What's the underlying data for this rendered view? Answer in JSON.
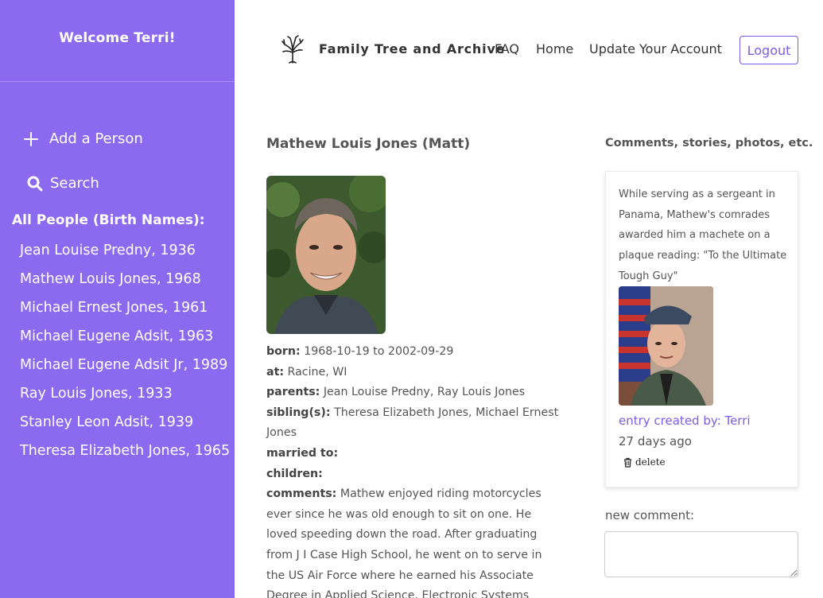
{
  "sidebar": {
    "welcome": "Welcome Terri!",
    "add_person": "Add a Person",
    "search": "Search",
    "people_title": "All People (Birth Names):",
    "people": [
      "Jean Louise Predny, 1936",
      "Mathew Louis Jones, 1968",
      "Michael Ernest Jones, 1961",
      "Michael Eugene Adsit, 1963",
      "Michael Eugene Adsit Jr, 1989",
      "Ray Louis Jones, 1933",
      "Stanley Leon Adsit, 1939",
      "Theresa Elizabeth Jones, 1965"
    ],
    "color": "#8c6af0"
  },
  "header": {
    "brand": "Family Tree and Archive",
    "nav": {
      "faq": "FAQ",
      "home": "Home",
      "update": "Update Your Account"
    },
    "logout": "Logout",
    "accent": "#7b5ce6"
  },
  "person": {
    "name": "Mathew Louis Jones (Matt)",
    "born_label": "born:",
    "born": "1968-10-19 to 2002-09-29",
    "at_label": "at:",
    "at": "Racine, WI",
    "parents_label": "parents:",
    "parents": "Jean Louise Predny, Ray Louis Jones",
    "siblings_label": "sibling(s):",
    "siblings": "Theresa Elizabeth Jones, Michael Ernest Jones",
    "married_label": "married to:",
    "married": "",
    "children_label": "children:",
    "children": "",
    "comments_label": "comments:",
    "comments": "Mathew enjoyed riding motorcycles ever since he was old enough to sit on one. He loved speeding down the road. After graduating from J I Case High School, he went on to serve in the US Air Force where he earned his Associate Degree in Applied Science, Electronic Systems"
  },
  "comments": {
    "title": "Comments, stories, photos, etc.",
    "items": [
      {
        "text": "While serving as a sergeant in Panama, Mathew's comrades awarded him a machete on a plaque reading: \"To the Ultimate Tough Guy\"",
        "created_by": "entry created by: Terri",
        "ago": "27 days ago",
        "delete": "delete"
      }
    ],
    "new_label": "new comment:",
    "new_value": ""
  },
  "icons": {
    "add": "plus-icon",
    "search": "search-icon",
    "logo": "tree-logo-icon",
    "delete": "trash-icon"
  }
}
